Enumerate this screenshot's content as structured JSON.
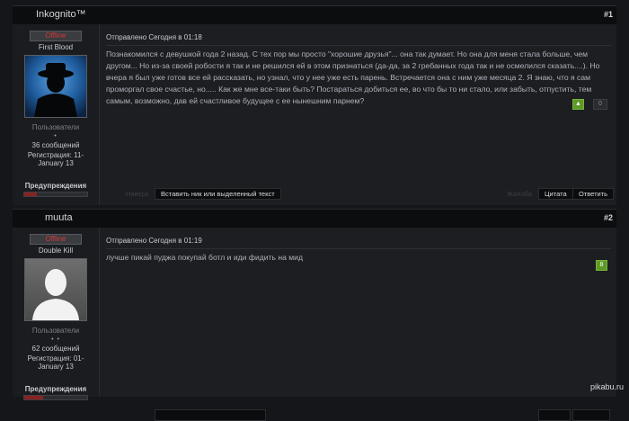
{
  "posts": [
    {
      "author": "Inkognito™",
      "number": "#1",
      "status": "Offline",
      "rank": "First Blood",
      "group": "Пользователи",
      "stars": "•",
      "messages": "36 сообщений",
      "registration": "Регистрация: 11-January 13",
      "warnings_label": "Предупреждения",
      "warning_level": 0.2,
      "posted": "Отправлено Сегодня в 01:18",
      "text": "Познакомился с девушкой года 2 назад. С тех пор мы просто \"хорошие друзья\"... она так думает. Но она для меня стала больше, чем другом... Но из-за своей робости я так и не решился ей в этом признаться (да-да, за 2 гребанных года так и не осмелился сказать....). Но вчера я был уже готов все ей рассказать, но узнал, что у нее уже есть парень. Встречается она с ним уже месяца 2. Я знаю, что я сам проморгал свое счастье, но..... Как же мне все-таки быть? Постараться добиться ее, во что бы то ни стало, или забыть, отпустить, тем самым, возможно, дав ей счастливое будущее с ее нынешним парнем?",
      "vote_up_icon": "arrow-up-icon",
      "vote_count": "0",
      "ghost_left": "Наверх",
      "insert_label": "Вставить ник или выделенный текст",
      "ghost_right": "Жалоба",
      "quote_label": "Цитата",
      "reply_label": "Ответить"
    },
    {
      "author": "muuta",
      "number": "#2",
      "status": "Offline",
      "rank": "Double Kill",
      "group": "Пользователи",
      "stars": "• •",
      "messages": "62 сообщений",
      "registration": "Регистрация: 01-January 13",
      "warnings_label": "Предупреждения",
      "warning_level": 0.3,
      "posted": "Отправлено Сегодня в 01:19",
      "text": "лучше пикай пуджа покупай ботл и иди фидить на мид",
      "vote_count": "8"
    }
  ],
  "watermark": "pikabu.ru"
}
